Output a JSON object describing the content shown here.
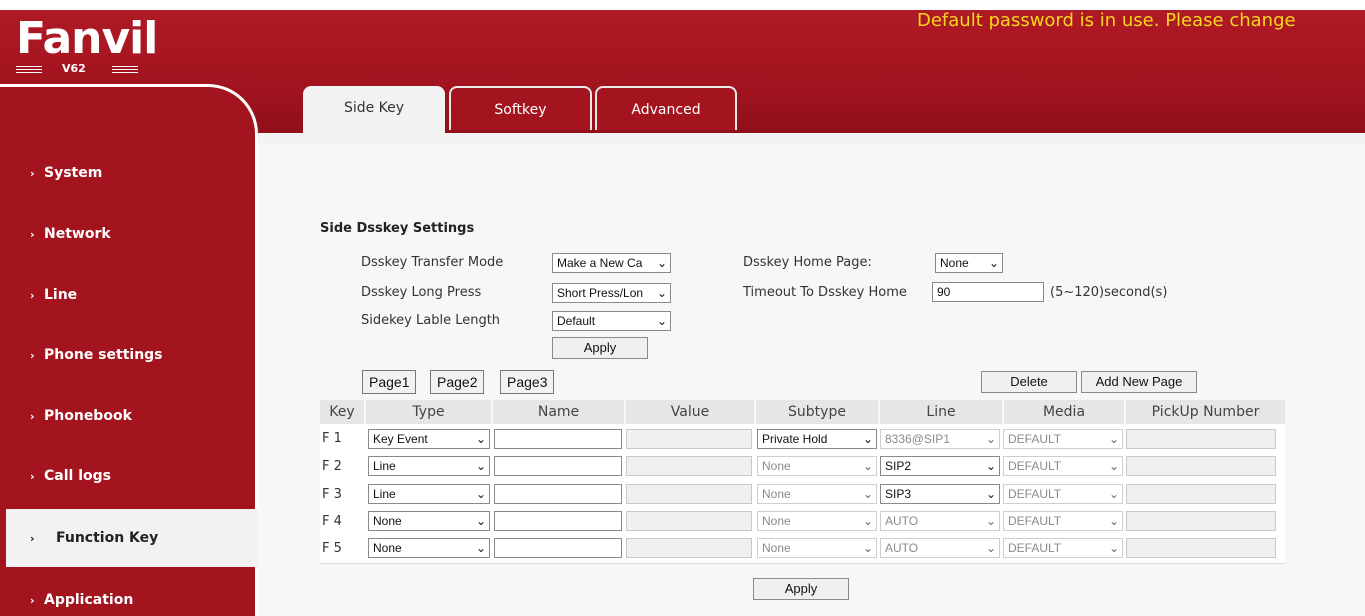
{
  "brand": {
    "logo": "Fanvil",
    "model": "V62"
  },
  "warning": "Default password is in use. Please change",
  "tabs": [
    {
      "label": "Side Key",
      "active": true
    },
    {
      "label": "Softkey",
      "active": false
    },
    {
      "label": "Advanced",
      "active": false
    }
  ],
  "sidebar": {
    "items": [
      {
        "label": "System"
      },
      {
        "label": "Network"
      },
      {
        "label": "Line"
      },
      {
        "label": "Phone settings"
      },
      {
        "label": "Phonebook"
      },
      {
        "label": "Call logs"
      },
      {
        "label": "Function Key",
        "active": true
      },
      {
        "label": "Application"
      }
    ]
  },
  "settings": {
    "title": "Side Dsskey Settings",
    "transfer_mode_label": "Dsskey Transfer Mode",
    "transfer_mode_value": "Make a New Ca",
    "long_press_label": "Dsskey Long Press",
    "long_press_value": "Short Press/Lon",
    "lable_length_label": "Sidekey Lable Length",
    "lable_length_value": "Default",
    "home_page_label": "Dsskey Home Page:",
    "home_page_value": "None",
    "timeout_label": "Timeout To Dsskey Home",
    "timeout_value": "90",
    "timeout_hint": "(5~120)second(s)",
    "apply_label": "Apply"
  },
  "pages": {
    "buttons": [
      "Page1",
      "Page2",
      "Page3"
    ],
    "delete_label": "Delete",
    "add_label": "Add New Page"
  },
  "table": {
    "headers": [
      "Key",
      "Type",
      "Name",
      "Value",
      "Subtype",
      "Line",
      "Media",
      "PickUp Number"
    ],
    "rows": [
      {
        "key": "F 1",
        "type": "Key Event",
        "name": "",
        "value": "",
        "subtype": "Private Hold",
        "subtype_enabled": true,
        "line": "8336@SIP1",
        "line_enabled": false,
        "media": "DEFAULT",
        "pickup": ""
      },
      {
        "key": "F 2",
        "type": "Line",
        "name": "",
        "value": "",
        "subtype": "None",
        "subtype_enabled": false,
        "line": "SIP2",
        "line_enabled": true,
        "media": "DEFAULT",
        "pickup": ""
      },
      {
        "key": "F 3",
        "type": "Line",
        "name": "",
        "value": "",
        "subtype": "None",
        "subtype_enabled": false,
        "line": "SIP3",
        "line_enabled": true,
        "media": "DEFAULT",
        "pickup": ""
      },
      {
        "key": "F 4",
        "type": "None",
        "name": "",
        "value": "",
        "subtype": "None",
        "subtype_enabled": false,
        "line": "AUTO",
        "line_enabled": false,
        "media": "DEFAULT",
        "pickup": ""
      },
      {
        "key": "F 5",
        "type": "None",
        "name": "",
        "value": "",
        "subtype": "None",
        "subtype_enabled": false,
        "line": "AUTO",
        "line_enabled": false,
        "media": "DEFAULT",
        "pickup": ""
      }
    ],
    "apply_label": "Apply"
  },
  "colors": {
    "brand_red": "#a3141f",
    "warning_yellow": "#f7d71c"
  }
}
